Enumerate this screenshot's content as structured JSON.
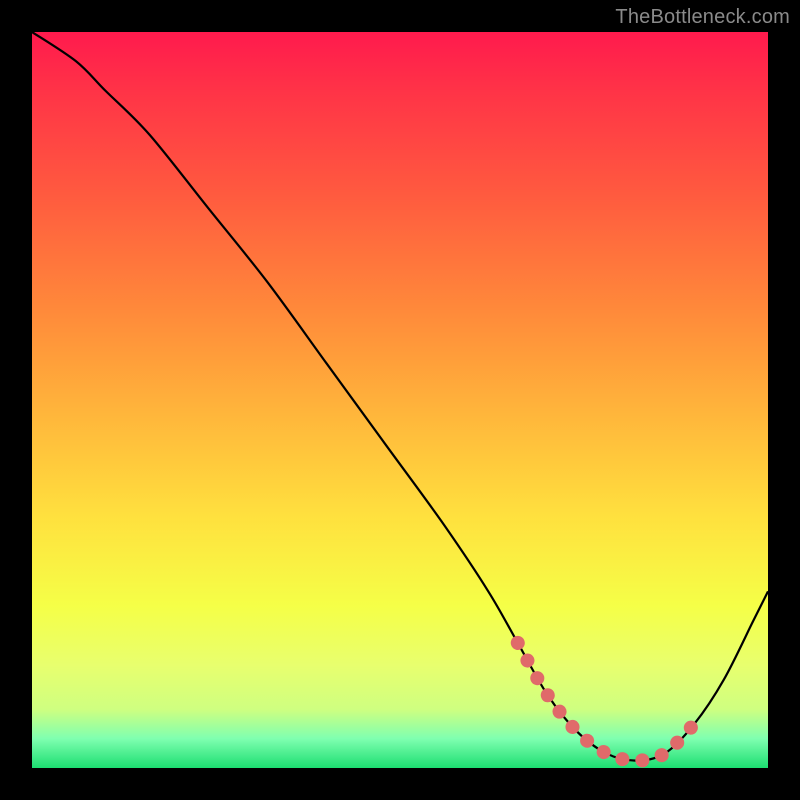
{
  "watermark": "TheBottleneck.com",
  "chart_data": {
    "type": "line",
    "title": "",
    "xlabel": "",
    "ylabel": "",
    "xlim": [
      0,
      100
    ],
    "ylim": [
      0,
      100
    ],
    "grid": false,
    "background": "vertical-gradient red→orange→yellow→green",
    "annotations": [
      {
        "name": "optimal-range-highlight",
        "x_start": 68,
        "x_end": 88,
        "color": "#e06a6a"
      }
    ],
    "series": [
      {
        "name": "bottleneck-curve",
        "x": [
          0,
          6,
          10,
          16,
          24,
          32,
          40,
          48,
          56,
          62,
          66,
          70,
          74,
          78,
          82,
          86,
          90,
          94,
          98,
          100
        ],
        "y": [
          100,
          96,
          92,
          86,
          76,
          66,
          55,
          44,
          33,
          24,
          17,
          10,
          5,
          2,
          1,
          2,
          6,
          12,
          20,
          24
        ]
      }
    ]
  }
}
